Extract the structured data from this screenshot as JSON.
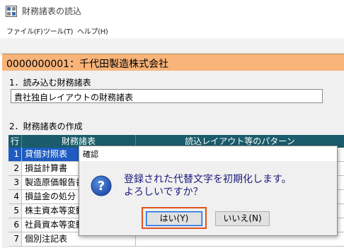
{
  "window": {
    "title": "財務諸表の読込",
    "menus": [
      "ファイル(F)",
      "ツール(T)",
      "ヘルプ(H)"
    ]
  },
  "company": {
    "header": "0000000001：千代田製造株式会社"
  },
  "section1": {
    "label": "1．読み込む財務諸表",
    "value": "貴社独自レイアウトの財務諸表"
  },
  "section2": {
    "label": "2．財務諸表の作成",
    "columns": [
      "行",
      "財務諸表",
      "読込レイアウト等のパターン"
    ],
    "rows": [
      {
        "num": "1",
        "name": "貸借対照表"
      },
      {
        "num": "2",
        "name": "損益計算書"
      },
      {
        "num": "3",
        "name": "製造原価報告書"
      },
      {
        "num": "4",
        "name": "損益金の処分"
      },
      {
        "num": "5",
        "name": "株主資本等変動"
      },
      {
        "num": "6",
        "name": "社員資本等変動"
      },
      {
        "num": "7",
        "name": "個別注記表"
      }
    ],
    "selected_index": 0
  },
  "dialog": {
    "title": "確認",
    "message_line1": "登録された代替文字を初期化します。",
    "message_line2": "よろしいですか？",
    "yes_label": "はい(Y)",
    "no_label": "いいえ(N)",
    "icon": "question-icon"
  },
  "colors": {
    "company_bar": "#f9b47a",
    "grid_header": "#1a5c6b",
    "selection": "#1e5cc2",
    "focus_highlight": "#e0531f"
  }
}
